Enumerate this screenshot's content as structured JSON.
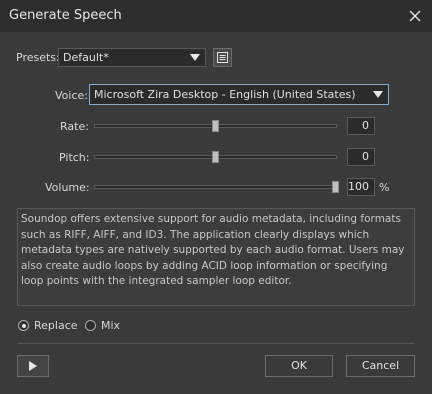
{
  "window": {
    "title": "Generate Speech",
    "close_icon": "close-icon"
  },
  "presets": {
    "label": "Presets:",
    "value": "Default*"
  },
  "voice": {
    "label": "Voice:",
    "value": "Microsoft Zira Desktop - English (United States)"
  },
  "rate": {
    "label": "Rate:",
    "value": "0",
    "level": 0.5
  },
  "pitch": {
    "label": "Pitch:",
    "value": "0",
    "level": 0.5
  },
  "volume": {
    "label": "Volume:",
    "value": "100",
    "unit": "%",
    "level": 1.0
  },
  "text": "Soundop offers extensive support for audio metadata, including formats such as RIFF, AIFF, and ID3. The application clearly displays which metadata types are natively supported by each audio format. Users may also create audio loops by adding ACID loop information or specifying loop points with the integrated sampler loop editor.",
  "mode": {
    "options": [
      "Replace",
      "Mix"
    ],
    "selected": "Replace"
  },
  "buttons": {
    "ok": "OK",
    "cancel": "Cancel"
  }
}
